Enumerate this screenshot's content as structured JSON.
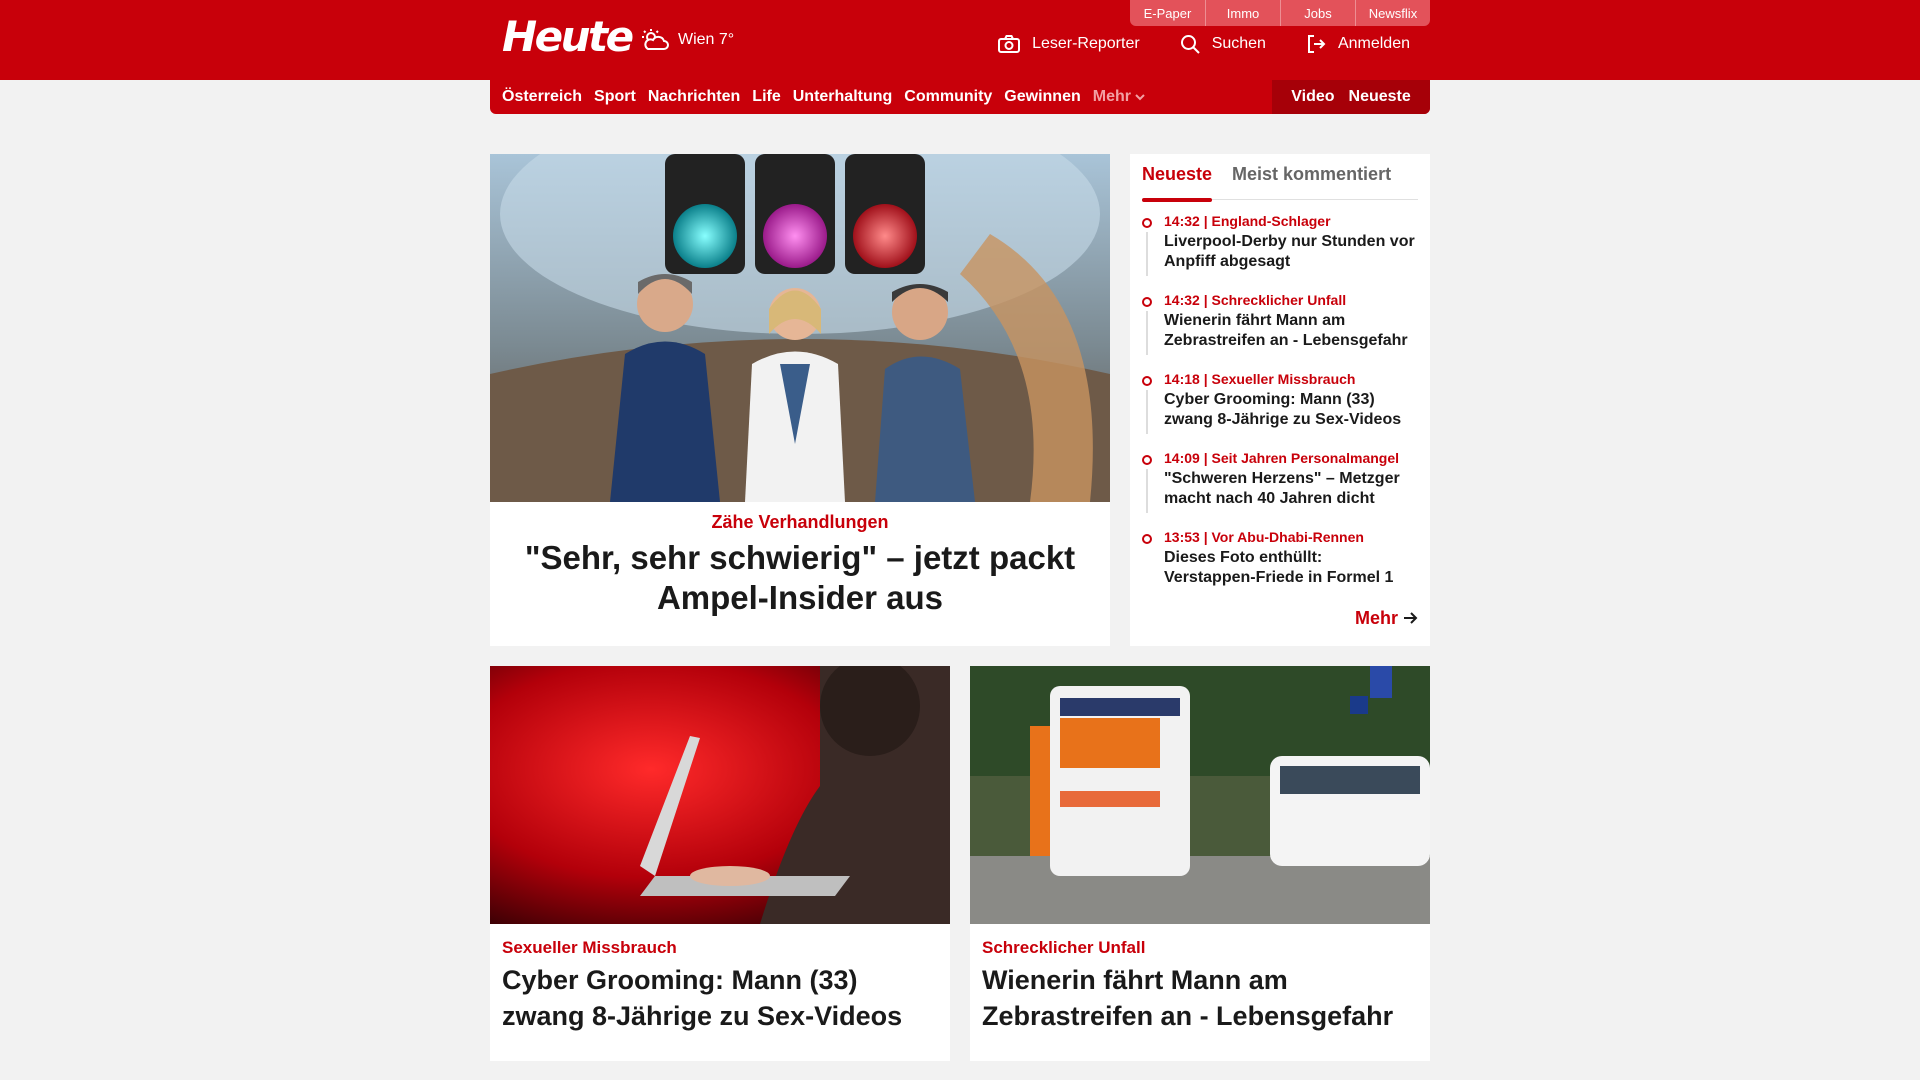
{
  "header": {
    "logo": "Heute",
    "weather": {
      "icon": "partly-cloudy-icon",
      "label": "Wien 7°"
    },
    "toplinks": [
      "E-Paper",
      "Immo",
      "Jobs",
      "Newsflix"
    ],
    "actions": [
      {
        "label": "Leser-Reporter",
        "icon": "camera-icon"
      },
      {
        "label": "Suchen",
        "icon": "search-icon"
      },
      {
        "label": "Anmelden",
        "icon": "login-icon"
      }
    ]
  },
  "nav": {
    "items": [
      "Österreich",
      "Sport",
      "Nachrichten",
      "Life",
      "Unterhaltung",
      "Community",
      "Gewinnen"
    ],
    "more": "Mehr",
    "right": [
      "Video",
      "Neueste"
    ]
  },
  "hero": {
    "image": "politicians-traffic-light-photo",
    "kicker": "Zähe Verhandlungen",
    "title": "\"Sehr, sehr schwierig\" – jetzt packt Ampel-Insider aus"
  },
  "sidebar": {
    "tabs": [
      "Neueste",
      "Meist kommentiert"
    ],
    "items": [
      {
        "meta": "14:32 | England-Schlager",
        "title": "Liverpool-Derby nur Stunden vor Anpfiff abgesagt"
      },
      {
        "meta": "14:32 | Schrecklicher Unfall",
        "title": "Wienerin fährt Mann am Zebrastreifen an - Lebensgefahr"
      },
      {
        "meta": "14:18 | Sexueller Missbrauch",
        "title": "Cyber Grooming: Mann (33) zwang 8-Jährige zu Sex-Videos"
      },
      {
        "meta": "14:09 | Seit Jahren Personalmangel",
        "title": "\"Schweren Herzens\" – Metzger macht nach 40 Jahren dicht"
      },
      {
        "meta": "13:53 | Vor Abu-Dhabi-Rennen",
        "title": "Dieses Foto enthüllt: Verstappen-Friede in Formel 1"
      }
    ],
    "more": "Mehr"
  },
  "cards": [
    {
      "image": "laptop-red-light-photo",
      "kicker": "Sexueller Missbrauch",
      "title": "Cyber Grooming: Mann (33) zwang 8-Jährige zu Sex-Videos"
    },
    {
      "image": "ambulance-street-photo",
      "kicker": "Schrecklicher Unfall",
      "title": "Wienerin fährt Mann am Zebrastreifen an - Lebensgefahr"
    }
  ],
  "colors": {
    "brand_red": "#c8000a",
    "dark_red": "#a60008",
    "background": "#f2f2f2"
  }
}
